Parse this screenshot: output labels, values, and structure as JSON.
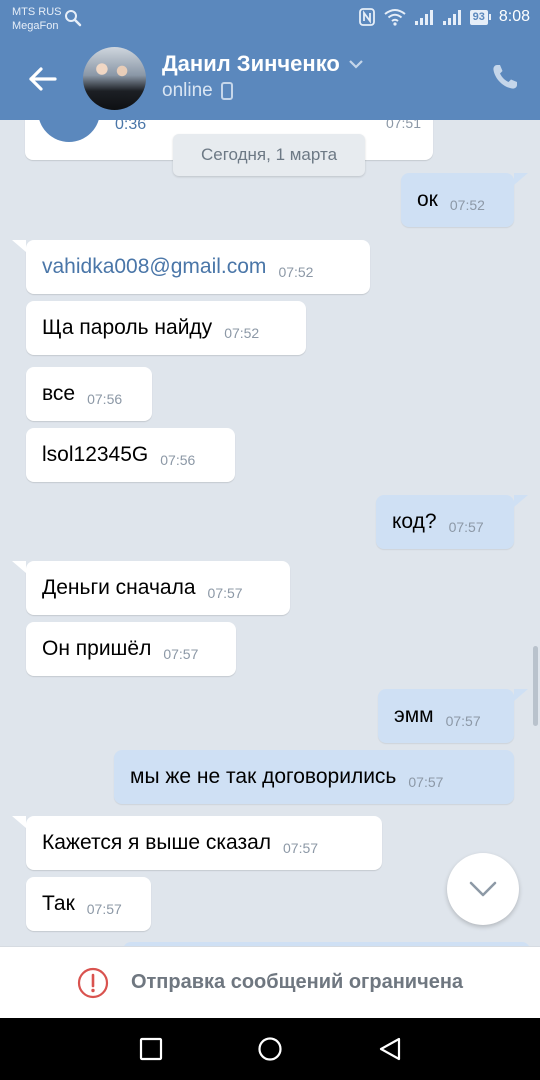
{
  "status_bar": {
    "carrier_1": "MTS RUS",
    "carrier_2": "MegaFon",
    "battery": "93",
    "time": "8:08"
  },
  "header": {
    "contact_name": "Данил Зинченко",
    "contact_status": "online"
  },
  "voice_message": {
    "duration": "0:36",
    "time": "07:51"
  },
  "date_separator": "Сегодня, 1 марта",
  "messages": [
    {
      "direction": "out",
      "text": "ок",
      "time": "07:52"
    },
    {
      "direction": "in",
      "text": "vahidka008@gmail.com",
      "time": "07:52"
    },
    {
      "direction": "in",
      "text": "Ща пароль найду",
      "time": "07:52"
    },
    {
      "direction": "in",
      "text": "все",
      "time": "07:56"
    },
    {
      "direction": "in",
      "text": "lsol12345G",
      "time": "07:56"
    },
    {
      "direction": "out",
      "text": "код?",
      "time": "07:57"
    },
    {
      "direction": "in",
      "text": "Деньги сначала",
      "time": "07:57"
    },
    {
      "direction": "in",
      "text": "Он пришёл",
      "time": "07:57"
    },
    {
      "direction": "out",
      "text": "эмм",
      "time": "07:57"
    },
    {
      "direction": "out",
      "text": "мы же не так договорились",
      "time": "07:57"
    },
    {
      "direction": "in",
      "text": "Кажется я выше сказал",
      "time": "07:57"
    },
    {
      "direction": "in",
      "text": "Так",
      "time": "07:57"
    }
  ],
  "restricted_notice": "Отправка сообщений ограничена",
  "colors": {
    "header": "#5b88bd",
    "incoming_bubble": "#ffffff",
    "outgoing_bubble": "#cfe0f4",
    "background": "#dfe5ec",
    "alert": "#d9534f"
  }
}
